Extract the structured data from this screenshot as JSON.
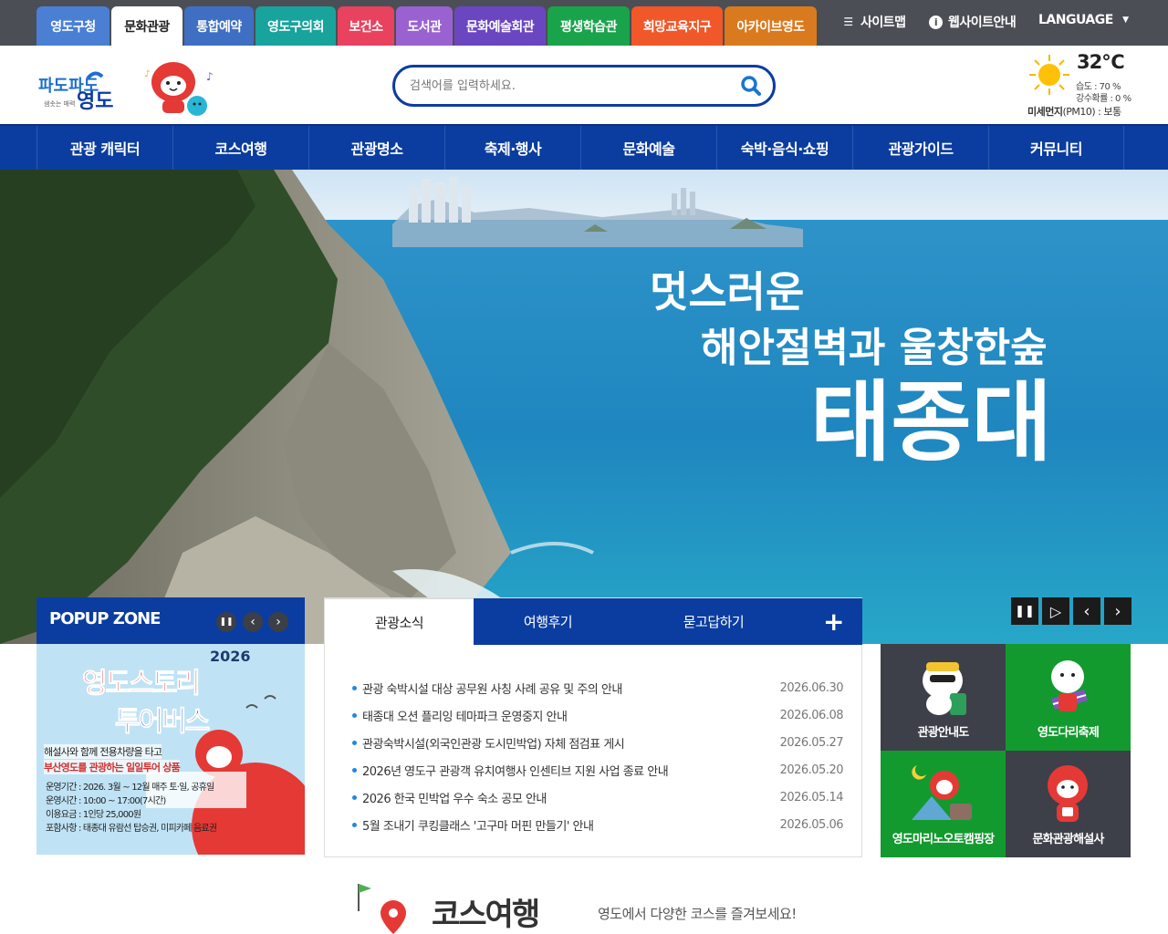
{
  "colors": {
    "primary": "#0b3da0",
    "topbar": "#4b4f55",
    "accent": "#1e88e5"
  },
  "site_tabs": [
    {
      "label": "영도구청",
      "color": "#4a7fd4"
    },
    {
      "label": "문화관광",
      "color": "#ffffff",
      "active": true
    },
    {
      "label": "통합예약",
      "color": "#3f6fc2"
    },
    {
      "label": "영도구의회",
      "color": "#18a39d"
    },
    {
      "label": "보건소",
      "color": "#e8425f"
    },
    {
      "label": "도서관",
      "color": "#9a62d0"
    },
    {
      "label": "문화예술회관",
      "color": "#6b46c1"
    },
    {
      "label": "평생학습관",
      "color": "#19a34a"
    },
    {
      "label": "희망교육지구",
      "color": "#f0582a"
    },
    {
      "label": "아카이브영도",
      "color": "#d97a1e"
    }
  ],
  "utility": {
    "sitemap": "사이트맵",
    "guide": "웹사이트안내",
    "language": "LANGUAGE",
    "sitemap_icon": "menu-icon",
    "guide_icon": "info-icon",
    "language_icon": "caret-down-icon"
  },
  "logo": {
    "line1": "파도파도",
    "line2": "영도",
    "tagline": "샘솟는 매력"
  },
  "search": {
    "placeholder": "검색어를 입력하세요.",
    "icon": "search-icon"
  },
  "weather": {
    "temp": "32℃",
    "humidity": "습도 : 70 %",
    "rain": "강수확률 : 0 %",
    "dust_label": "미세먼지",
    "dust_unit": "(PM10) : 보통",
    "icon": "sun-icon"
  },
  "gnb": [
    "관광 캐릭터",
    "코스여행",
    "관광명소",
    "축제·행사",
    "문화예술",
    "숙박·음식·쇼핑",
    "관광가이드",
    "커뮤니티"
  ],
  "hero": {
    "line1": "멋스러운",
    "line2": "해안절벽과 울창한숲",
    "line3": "태종대"
  },
  "popup": {
    "title": "POPUP ZONE",
    "banner_year": "2026",
    "banner_title1": "영도스토리",
    "banner_title2": "투어버스",
    "banner_desc1": "해설사와 함께 전용차량을 타고",
    "banner_desc2": "부산영도를 관광하는 일일투어 상품",
    "banner_info": [
      "운영기간 : 2026. 3월 ~ 12월 매주 토·일, 공휴일",
      "운영시간 : 10:00 ~ 17:00(7시간)",
      "이용요금 : 1인당 25,000원",
      "포함사항 : 태종대 유람선 탑승권, 미피카페 음료권"
    ]
  },
  "news": {
    "tabs": [
      "관광소식",
      "여행후기",
      "묻고답하기"
    ],
    "more": "+",
    "items": [
      {
        "title": "관광 숙박시설 대상 공무원 사칭 사례 공유 및 주의 안내",
        "date": "2026.06.30"
      },
      {
        "title": "태종대 오션 플리잉 테마파크 운영중지 안내",
        "date": "2026.06.08"
      },
      {
        "title": "관광숙박시설(외국인관광 도시민박업) 자체 점검표 게시",
        "date": "2026.05.27"
      },
      {
        "title": "2026년 영도구 관광객 유치여행사 인센티브 지원 사업 종료 안내",
        "date": "2026.05.20"
      },
      {
        "title": "2026 한국 민박업 우수 숙소 공모 안내",
        "date": "2026.05.14"
      },
      {
        "title": "5월 조내기 쿠킹클래스 '고구마 머핀 만들기' 안내",
        "date": "2026.05.06"
      }
    ]
  },
  "quick": [
    {
      "label": "관광안내도",
      "color": "#3d4049"
    },
    {
      "label": "영도다리축제",
      "color": "#139a2f"
    },
    {
      "label": "영도마리노오토캠핑장",
      "color": "#139a2f"
    },
    {
      "label": "문화관광해설사",
      "color": "#3d4049"
    }
  ],
  "course": {
    "title": "코스여행",
    "subtitle": "영도에서 다양한 코스를 즐겨보세요!"
  }
}
